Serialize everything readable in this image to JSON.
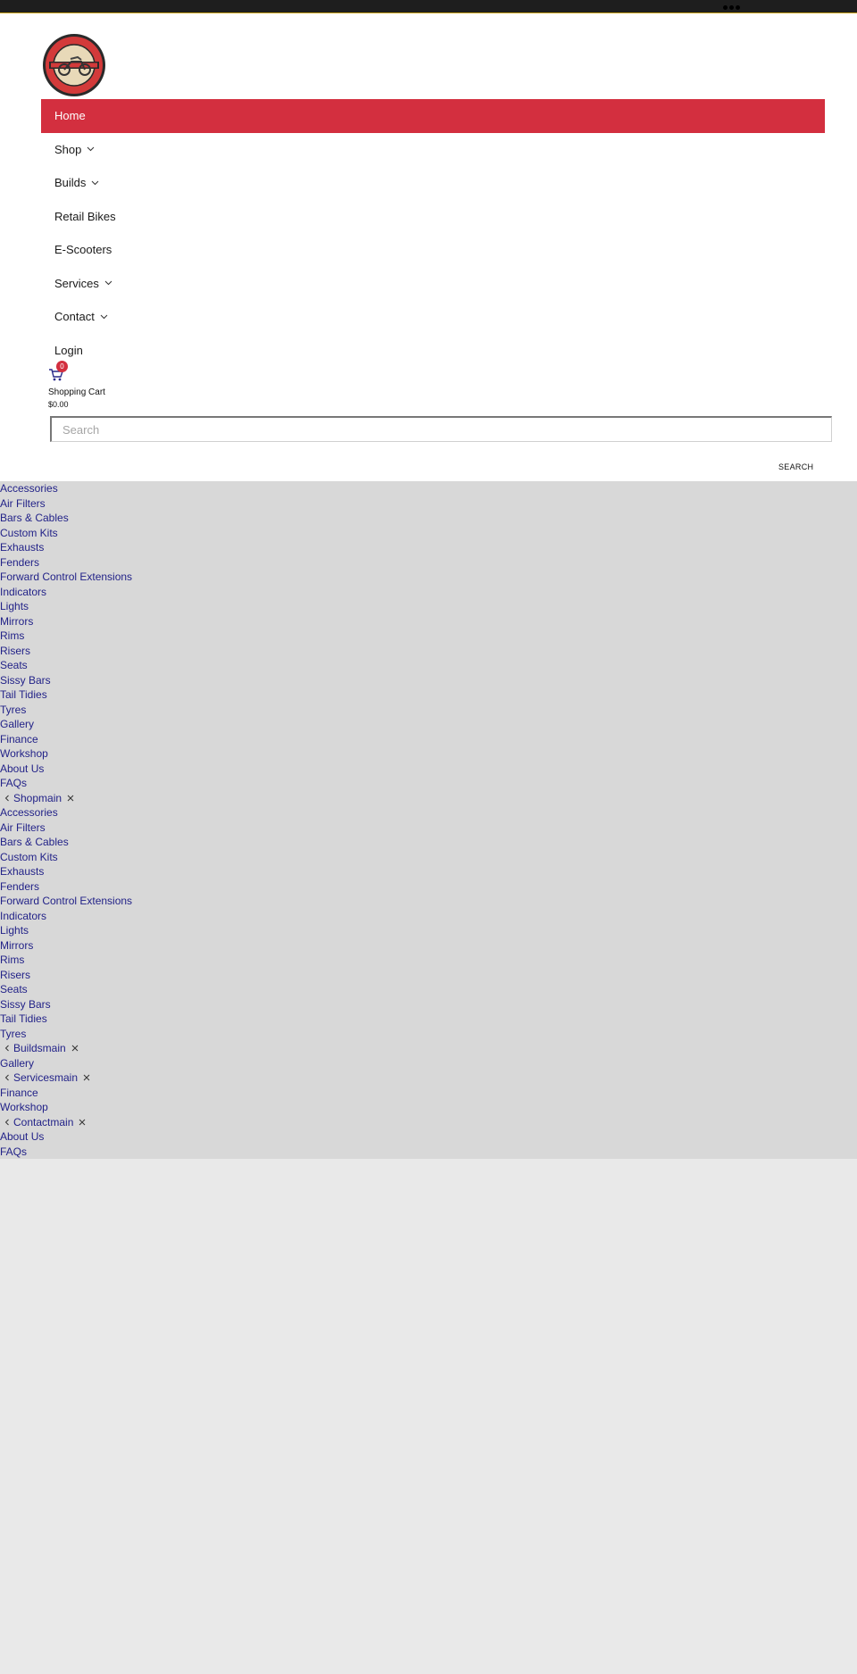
{
  "brand": {
    "logo_alt": "Nightshift Bobbers"
  },
  "nav": {
    "items": [
      {
        "label": "Home",
        "has_dropdown": false,
        "active": true
      },
      {
        "label": "Shop",
        "has_dropdown": true
      },
      {
        "label": "Builds",
        "has_dropdown": true
      },
      {
        "label": "Retail Bikes",
        "has_dropdown": false
      },
      {
        "label": "E-Scooters",
        "has_dropdown": false
      },
      {
        "label": "Services",
        "has_dropdown": true
      },
      {
        "label": "Contact",
        "has_dropdown": true
      },
      {
        "label": "Login",
        "has_dropdown": false
      }
    ]
  },
  "cart": {
    "count": "0",
    "label": "Shopping Cart",
    "total": "$0.00"
  },
  "search": {
    "placeholder": "Search",
    "button_label": "SEARCH"
  },
  "menu": {
    "links": [
      "Accessories",
      "Air Filters",
      "Bars & Cables",
      "Custom Kits",
      "Exhausts",
      "Fenders",
      "Forward Control Extensions",
      "Indicators",
      "Lights",
      "Mirrors",
      "Rims",
      "Risers",
      "Seats",
      "Sissy Bars",
      "Tail Tidies",
      "Tyres",
      "Gallery",
      "Finance",
      "Workshop",
      "About Us",
      "FAQs",
      {
        "submenu": "Shopmain"
      },
      "Accessories",
      "Air Filters",
      "Bars & Cables",
      "Custom Kits",
      "Exhausts",
      "Fenders",
      "Forward Control Extensions",
      "Indicators",
      "Lights",
      "Mirrors",
      "Rims",
      "Risers",
      "Seats",
      "Sissy Bars",
      "Tail Tidies",
      "Tyres",
      {
        "submenu": "Buildsmain"
      },
      "Gallery",
      {
        "submenu": "Servicesmain"
      },
      "Finance",
      "Workshop",
      {
        "submenu": "Contactmain"
      },
      "About Us",
      "FAQs"
    ]
  },
  "colors": {
    "accent": "#d32f3f",
    "link": "#222288",
    "menu_bg": "#d8d8d8",
    "page_bg": "#e9e9e9",
    "topbar": "#1e1e1e"
  }
}
